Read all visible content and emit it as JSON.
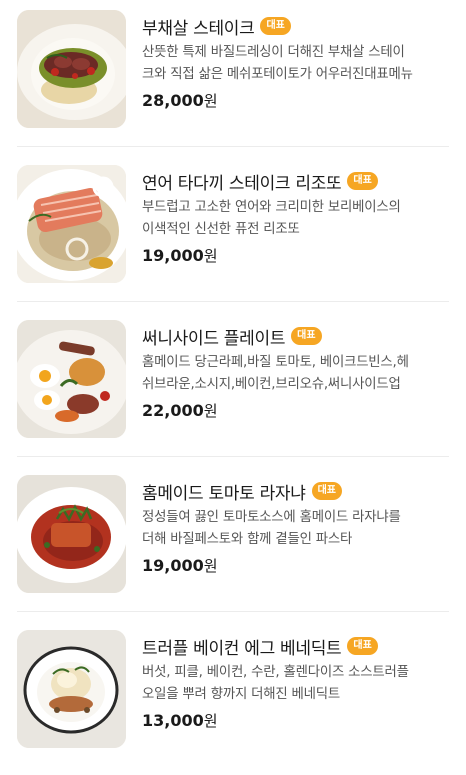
{
  "menu": {
    "items": [
      {
        "name": "부채살 스테이크",
        "badge": "대표",
        "desc_line1": "산뜻한 특제 바질드레싱이 더해진 부채살 스테이",
        "desc_line2": "크와 직접 삶은 메쉬포테이토가 어우러진대표메뉴",
        "price": "28,000",
        "unit": "원"
      },
      {
        "name": "연어 타다끼 스테이크 리조또",
        "badge": "대표",
        "desc_line1": "부드럽고 고소한 연어와 크리미한 보리베이스의",
        "desc_line2": "이색적인 신선한 퓨전 리조또",
        "price": "19,000",
        "unit": "원"
      },
      {
        "name": "써니사이드 플레이트",
        "badge": "대표",
        "desc_line1": "홈메이드 당근라페,바질 토마토, 베이크드빈스,헤",
        "desc_line2": "쉬브라운,소시지,베이컨,브리오슈,써니사이드업",
        "price": "22,000",
        "unit": "원"
      },
      {
        "name": "홈메이드 토마토 라자냐",
        "badge": "대표",
        "desc_line1": "정성들여 끓인 토마토소스에 홈메이드 라자냐를",
        "desc_line2": "더해 바질페스토와 함께 곁들인 파스타",
        "price": "19,000",
        "unit": "원"
      },
      {
        "name": "트러플 베이컨 에그 베네딕트",
        "badge": "대표",
        "desc_line1": "버섯, 피클, 베이컨, 수란, 홀렌다이즈 소스트러플",
        "desc_line2": "오일을 뿌려 향까지 더해진 베네딕트",
        "price": "13,000",
        "unit": "원"
      }
    ]
  },
  "colors": {
    "badge_bg": "#f6a623",
    "text_primary": "#1a1a1a",
    "text_secondary": "#555555",
    "divider": "#ececec"
  }
}
